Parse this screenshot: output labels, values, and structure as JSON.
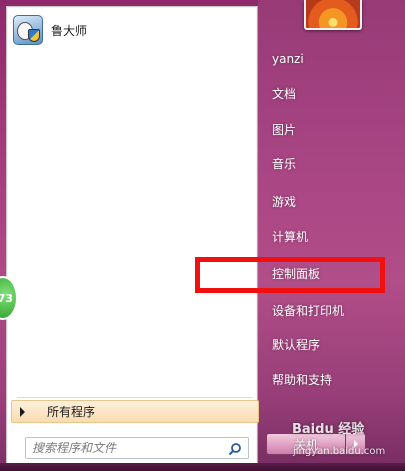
{
  "left_panel": {
    "pinned": [
      {
        "label": "鲁大师",
        "icon": "ludashi-app-icon"
      }
    ],
    "all_programs_label": "所有程序",
    "search": {
      "placeholder": "搜索程序和文件",
      "value": ""
    }
  },
  "right_panel": {
    "items": [
      {
        "label": "yanzi"
      },
      {
        "label": "文档"
      },
      {
        "label": "图片"
      },
      {
        "label": "音乐"
      },
      {
        "label": "游戏"
      },
      {
        "label": "计算机"
      },
      {
        "label": "控制面板"
      },
      {
        "label": "设备和打印机"
      },
      {
        "label": "默认程序"
      },
      {
        "label": "帮助和支持"
      }
    ],
    "shutdown_label": "关机",
    "highlighted_item": "控制面板"
  },
  "overlay": {
    "badge_text": "73",
    "watermark_text": "Baidu 经验",
    "watermark_url": "jingyan.baidu.com"
  },
  "colors": {
    "highlight_box": "#f01010",
    "background_accent": "#a23a7c"
  }
}
